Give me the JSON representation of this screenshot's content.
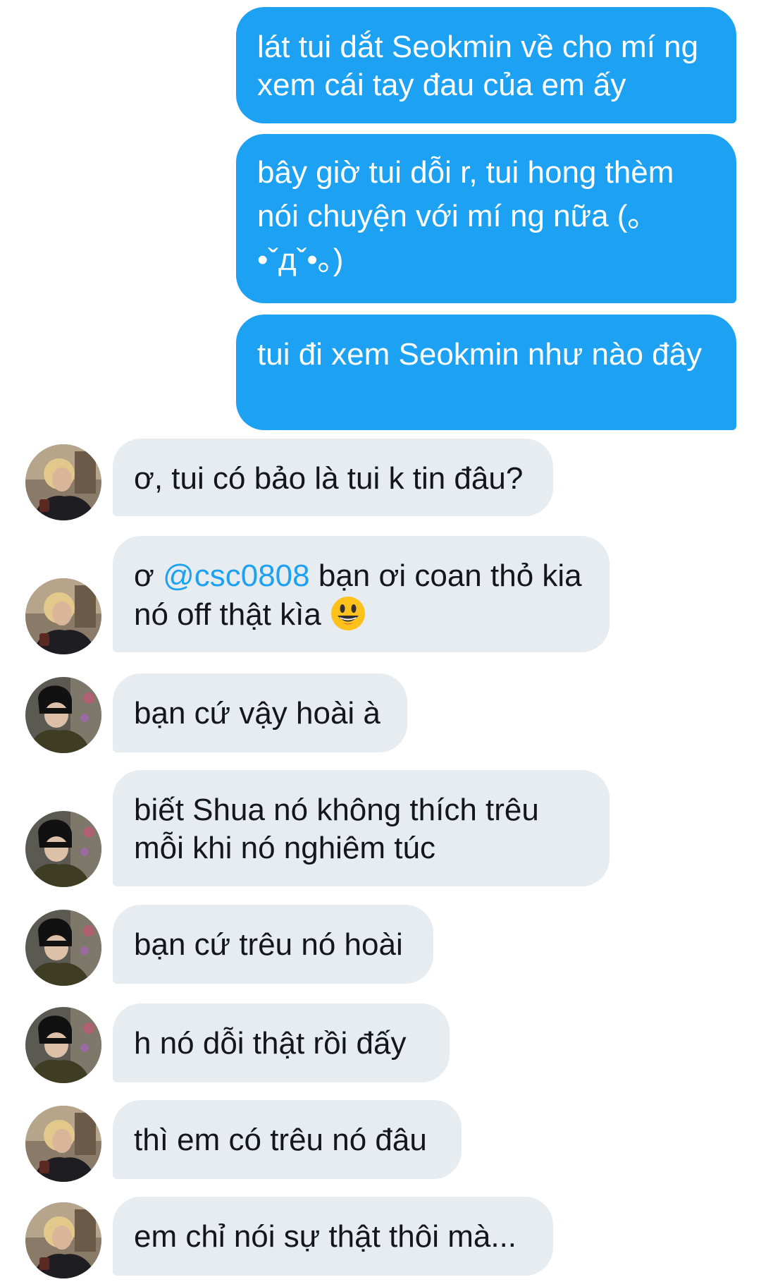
{
  "messages": [
    {
      "id": "m1",
      "direction": "out",
      "text": "lát tui dắt Seokmin về cho mí ng xem cái tay đau của em ấy"
    },
    {
      "id": "m2",
      "direction": "out",
      "text": "bây giờ tui dỗi r, tui hong thèm nói chuyện với mí ng nữa (｡•ˇдˇ•｡)"
    },
    {
      "id": "m3",
      "direction": "out",
      "text": "tui đi xem Seokmin như nào đây"
    },
    {
      "id": "m4",
      "direction": "in",
      "sender": "blonde",
      "text": "ơ, tui có bảo là tui k tin đâu?"
    },
    {
      "id": "m5",
      "direction": "in",
      "sender": "blonde",
      "text_prefix": "ơ ",
      "mention": "@csc0808",
      "text_suffix": " bạn ơi coan thỏ kia nó off thật kìa",
      "emoji": "smiley-face-emoji"
    },
    {
      "id": "m6",
      "direction": "in",
      "sender": "dark-hair",
      "text": "bạn cứ vậy hoài à"
    },
    {
      "id": "m7",
      "direction": "in",
      "sender": "dark-hair",
      "text": "biết Shua nó không thích trêu mỗi khi nó nghiêm túc"
    },
    {
      "id": "m8",
      "direction": "in",
      "sender": "dark-hair",
      "text": "bạn cứ trêu nó hoài"
    },
    {
      "id": "m9",
      "direction": "in",
      "sender": "dark-hair",
      "text": "h nó dỗi thật rồi đấy"
    },
    {
      "id": "m10",
      "direction": "in",
      "sender": "blonde",
      "text": "thì em có trêu nó đâu"
    },
    {
      "id": "m11",
      "direction": "in",
      "sender": "blonde",
      "text": "em chỉ nói sự thật thôi mà..."
    }
  ],
  "colors": {
    "outgoing_bubble": "#1da1f2",
    "incoming_bubble": "#e6ecf0",
    "mention": "#1da1f2",
    "text_dark": "#14171a"
  }
}
